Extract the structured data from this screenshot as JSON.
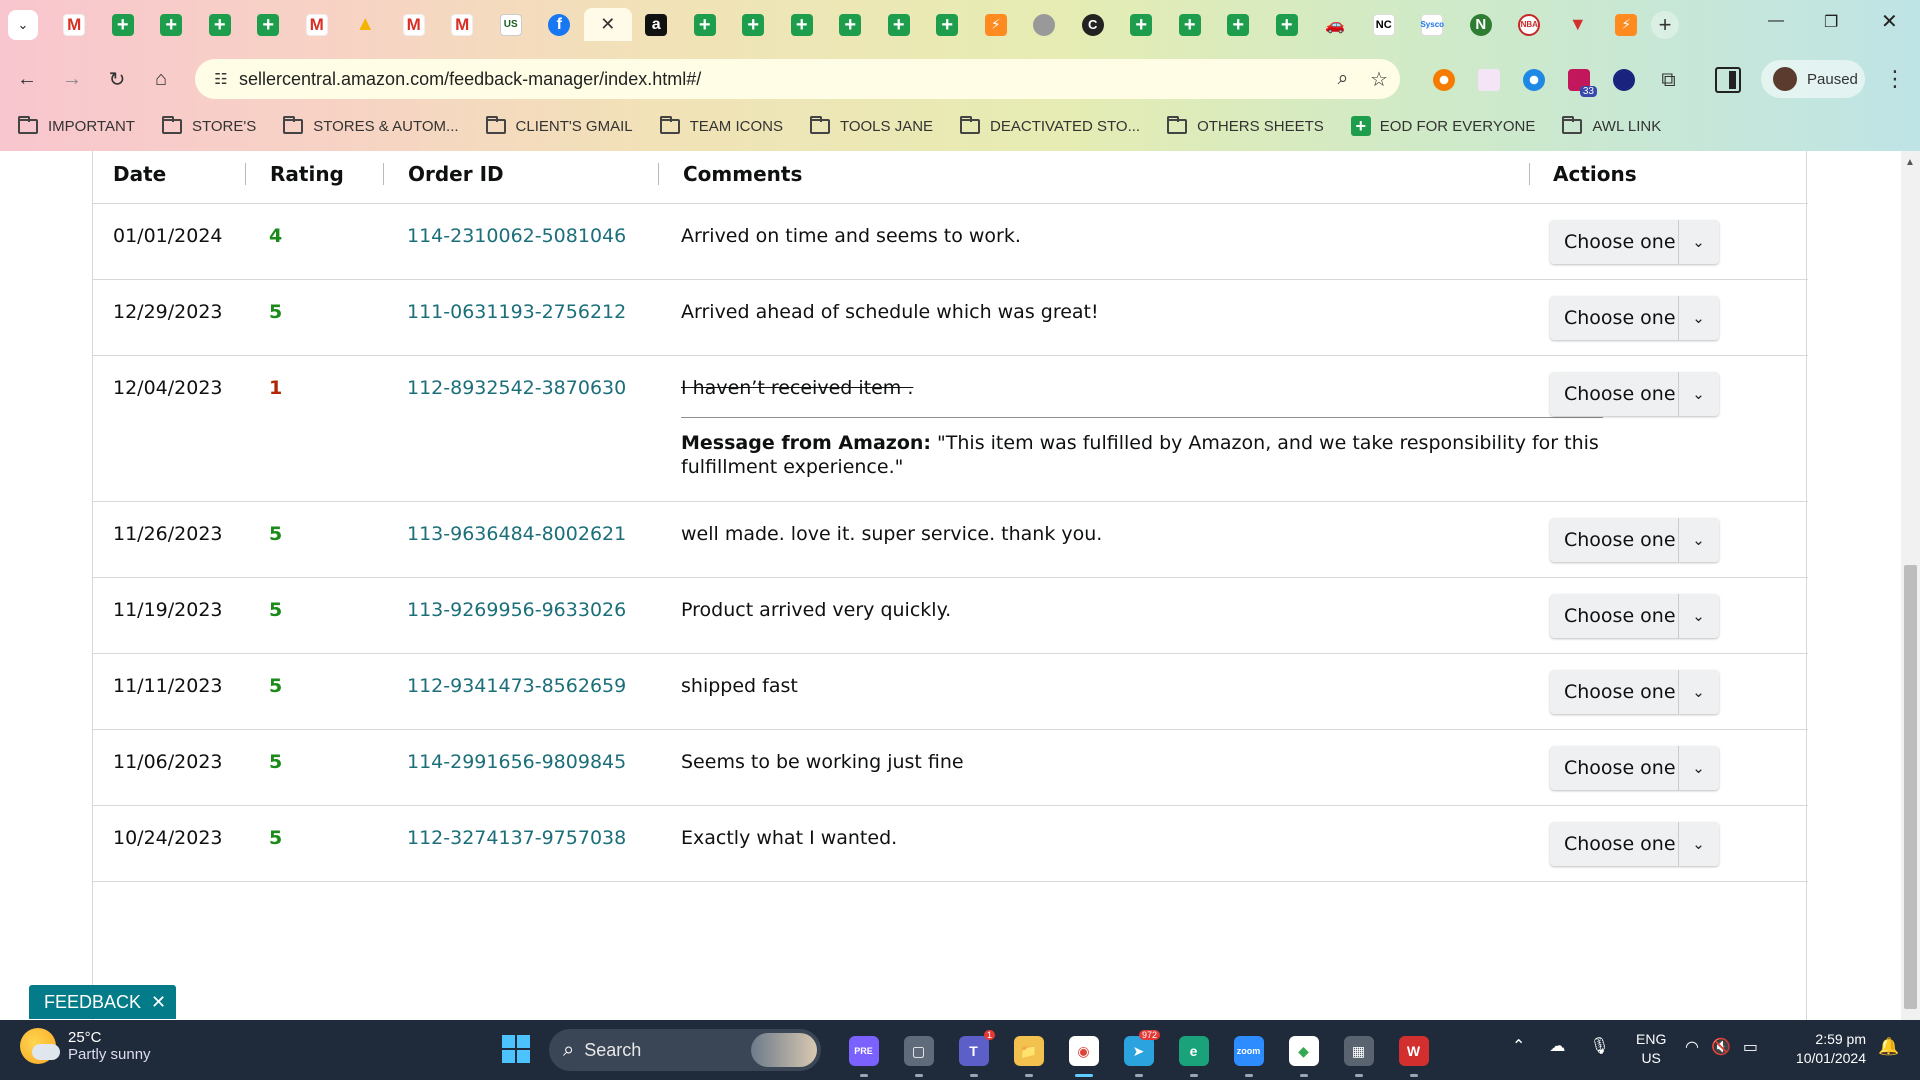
{
  "browser": {
    "url": "sellercentral.amazon.com/feedback-manager/index.html#/",
    "profile_label": "Paused",
    "extension_count": "33",
    "tabs": [
      {
        "icon": "gmail-icon",
        "glyph": "M"
      },
      {
        "icon": "sheets-icon",
        "glyph": "+"
      },
      {
        "icon": "sheets-icon",
        "glyph": "+"
      },
      {
        "icon": "sheets-icon",
        "glyph": "+"
      },
      {
        "icon": "sheets-icon",
        "glyph": "+"
      },
      {
        "icon": "gmail-icon",
        "glyph": "M"
      },
      {
        "icon": "drive-icon",
        "glyph": "▲"
      },
      {
        "icon": "gmail-icon",
        "glyph": "M"
      },
      {
        "icon": "gmail-icon",
        "glyph": "M"
      },
      {
        "icon": "usfoods-icon",
        "glyph": "US"
      },
      {
        "icon": "facebook-icon",
        "glyph": "f"
      },
      {
        "icon": "close-icon",
        "glyph": "✕"
      },
      {
        "icon": "amazon-icon",
        "glyph": "a"
      },
      {
        "icon": "sheets-icon",
        "glyph": "+"
      },
      {
        "icon": "sheets-icon",
        "glyph": "+"
      },
      {
        "icon": "sheets-icon",
        "glyph": "+"
      },
      {
        "icon": "sheets-icon",
        "glyph": "+"
      },
      {
        "icon": "sheets-icon",
        "glyph": "+"
      },
      {
        "icon": "sheets-icon",
        "glyph": "+"
      },
      {
        "icon": "zapier-icon",
        "glyph": "⚡"
      },
      {
        "icon": "grey-circle-icon",
        "glyph": ""
      },
      {
        "icon": "c-circle-icon",
        "glyph": "C"
      },
      {
        "icon": "sheets-icon",
        "glyph": "+"
      },
      {
        "icon": "sheets-icon",
        "glyph": "+"
      },
      {
        "icon": "sheets-icon",
        "glyph": "+"
      },
      {
        "icon": "sheets-icon",
        "glyph": "+"
      },
      {
        "icon": "car-icon",
        "glyph": "🚗"
      },
      {
        "icon": "nc-icon",
        "glyph": "NC"
      },
      {
        "icon": "sysco-icon",
        "glyph": "Sysco"
      },
      {
        "icon": "n-logo-icon",
        "glyph": "N"
      },
      {
        "icon": "badge-icon",
        "glyph": "NBA"
      },
      {
        "icon": "red-triangle-icon",
        "glyph": "▼"
      },
      {
        "icon": "zapier-icon",
        "glyph": "⚡"
      }
    ],
    "bookmarks": [
      {
        "type": "folder",
        "label": "IMPORTANT"
      },
      {
        "type": "folder",
        "label": "STORE'S"
      },
      {
        "type": "folder",
        "label": "STORES & AUTOM..."
      },
      {
        "type": "folder",
        "label": "CLIENT'S GMAIL"
      },
      {
        "type": "folder",
        "label": "TEAM ICONS"
      },
      {
        "type": "folder",
        "label": "TOOLS JANE"
      },
      {
        "type": "folder",
        "label": "DEACTIVATED STO..."
      },
      {
        "type": "folder",
        "label": "OTHERS SHEETS"
      },
      {
        "type": "sheet",
        "label": "EOD FOR EVERYONE"
      },
      {
        "type": "folder",
        "label": "AWL LINK"
      }
    ]
  },
  "table": {
    "headers": {
      "date": "Date",
      "rating": "Rating",
      "order_id": "Order ID",
      "comments": "Comments",
      "actions": "Actions"
    },
    "action_label": "Choose one",
    "rows": [
      {
        "date": "01/01/2024",
        "rating": "4",
        "order_id": "114-2310062-5081046",
        "comment": "Arrived on time and seems to work."
      },
      {
        "date": "12/29/2023",
        "rating": "5",
        "order_id": "111-0631193-2756212",
        "comment": "Arrived ahead of schedule which was great!"
      },
      {
        "date": "12/04/2023",
        "rating": "1",
        "order_id": "112-8932542-3870630",
        "comment": "I haven’t received item .",
        "struck": true,
        "amazon_message_label": "Message from Amazon:",
        "amazon_message": "\"This item was fulfilled by Amazon, and we take responsibility for this fulfillment experience.\""
      },
      {
        "date": "11/26/2023",
        "rating": "5",
        "order_id": "113-9636484-8002621",
        "comment": "well made. love it. super service. thank you."
      },
      {
        "date": "11/19/2023",
        "rating": "5",
        "order_id": "113-9269956-9633026",
        "comment": "Product arrived very quickly."
      },
      {
        "date": "11/11/2023",
        "rating": "5",
        "order_id": "112-9341473-8562659",
        "comment": "shipped fast"
      },
      {
        "date": "11/06/2023",
        "rating": "5",
        "order_id": "114-2991656-9809845",
        "comment": "Seems to be working just fine"
      },
      {
        "date": "10/24/2023",
        "rating": "5",
        "order_id": "112-3274137-9757038",
        "comment": "Exactly what I wanted."
      }
    ]
  },
  "feedback_tab": {
    "label": "FEEDBACK",
    "close": "✕"
  },
  "taskbar": {
    "weather_temp": "25°C",
    "weather_desc": "Partly sunny",
    "search_label": "Search",
    "apps": [
      {
        "name": "copilot-app-icon",
        "glyph": "PRE",
        "bg": "#7b61ff",
        "fg": "#ffffff"
      },
      {
        "name": "task-view-icon",
        "glyph": "▢",
        "bg": "#5f6b7a",
        "fg": "#ffffff"
      },
      {
        "name": "teams-app-icon",
        "glyph": "T",
        "bg": "#5b5fc7",
        "fg": "#ffffff",
        "badge": "1"
      },
      {
        "name": "file-explorer-icon",
        "glyph": "📁",
        "bg": "#f2c14e",
        "fg": "#7a4b00"
      },
      {
        "name": "chrome-app-icon",
        "glyph": "◉",
        "bg": "#ffffff",
        "fg": "#db4437",
        "running": true
      },
      {
        "name": "telegram-app-icon",
        "glyph": "➤",
        "bg": "#2aa3df",
        "fg": "#ffffff",
        "badge": "972"
      },
      {
        "name": "edge-app-icon",
        "glyph": "e",
        "bg": "#1aa37a",
        "fg": "#ffffff"
      },
      {
        "name": "zoom-app-icon",
        "glyph": "zoom",
        "bg": "#2d8cff",
        "fg": "#ffffff"
      },
      {
        "name": "maps-app-icon",
        "glyph": "◆",
        "bg": "#ffffff",
        "fg": "#34a853"
      },
      {
        "name": "calculator-app-icon",
        "glyph": "▦",
        "bg": "#5a6470",
        "fg": "#ffffff"
      },
      {
        "name": "wps-app-icon",
        "glyph": "W",
        "bg": "#d32f2f",
        "fg": "#ffffff"
      }
    ],
    "lang_line1": "ENG",
    "lang_line2": "US",
    "time": "2:59 pm",
    "date": "10/01/2024"
  }
}
